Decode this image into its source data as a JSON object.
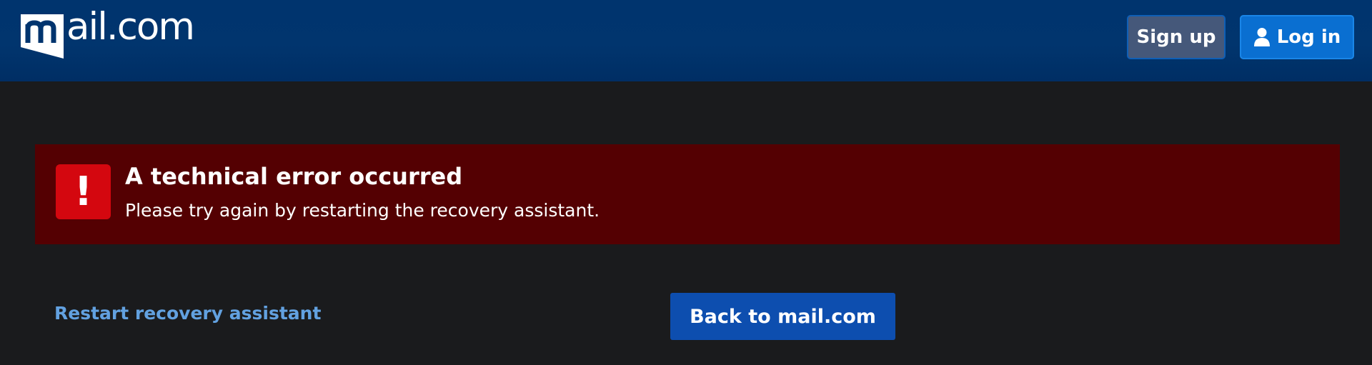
{
  "header": {
    "logo_text": "ail.com",
    "logo_mark_letter": "m",
    "signup_label": "Sign up",
    "login_label": "Log in",
    "login_icon": "user-icon"
  },
  "alert": {
    "icon": "exclamation-icon",
    "icon_glyph": "!",
    "title": "A technical error occurred",
    "message": "Please try again by restarting the recovery assistant."
  },
  "actions": {
    "restart_link": "Restart recovery assistant",
    "back_button": "Back to mail.com"
  },
  "colors": {
    "header_bg": "#00346e",
    "page_bg": "#1a1b1d",
    "alert_bg": "#540002",
    "alert_icon_bg": "#d4070f",
    "link": "#62a1e0",
    "primary_button": "#0d4eaf",
    "login_button": "#0a6fd1",
    "signup_button": "#45587a"
  }
}
